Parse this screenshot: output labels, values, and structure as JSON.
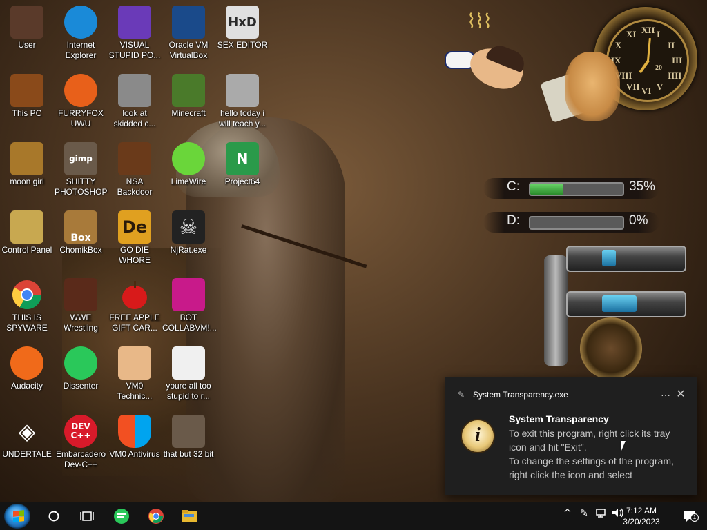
{
  "desktop": {
    "icons": [
      {
        "label": "User",
        "icon": "user-folder-icon",
        "color": "#5a3a2a"
      },
      {
        "label": "Internet Explorer",
        "icon": "edge-icon",
        "color": "#1a8ad8"
      },
      {
        "label": "VISUAL STUPID PO...",
        "icon": "visual-studio-icon",
        "color": "#6a3ab8"
      },
      {
        "label": "Oracle VM VirtualBox",
        "icon": "virtualbox-icon",
        "color": "#1a4a8a"
      },
      {
        "label": "SEX EDITOR",
        "icon": "hex-editor-icon",
        "color": "#e0e0e0"
      },
      {
        "label": "This PC",
        "icon": "this-pc-icon",
        "color": "#8a4a1a"
      },
      {
        "label": "FURRYFOX UWU",
        "icon": "firefox-icon",
        "color": "#e8601a"
      },
      {
        "label": "look at skidded c...",
        "icon": "copy-icon",
        "color": "#8a8a8a"
      },
      {
        "label": "Minecraft",
        "icon": "minecraft-icon",
        "color": "#4a7a2a"
      },
      {
        "label": "hello today i will teach y...",
        "icon": "pixel-image-icon",
        "color": "#aaaaaa"
      },
      {
        "label": "moon girl",
        "icon": "folder-icon",
        "color": "#a8782a"
      },
      {
        "label": "SHITTY PHOTOSHOP",
        "icon": "gimp-icon",
        "color": "#6a5a4a"
      },
      {
        "label": "NSA Backdoor",
        "icon": "nsa-icon",
        "color": "#6a3a1a"
      },
      {
        "label": "LimeWire",
        "icon": "limewire-icon",
        "color": "#6ad63a"
      },
      {
        "label": "Project64",
        "icon": "project64-icon",
        "color": "#2a9a4a"
      },
      {
        "label": "Control Panel",
        "icon": "control-panel-icon",
        "color": "#c8a850"
      },
      {
        "label": "ChomikBox",
        "icon": "chomikbox-icon",
        "color": "#a87a3a"
      },
      {
        "label": "GO DIE WHORE",
        "icon": "de-icon",
        "color": "#e0a020"
      },
      {
        "label": "NjRat.exe",
        "icon": "skull-icon",
        "color": "#dddddd"
      },
      {
        "label": "THIS IS SPYWARE",
        "icon": "chrome-icon",
        "color": "#db4437"
      },
      {
        "label": "WWE Wrestling",
        "icon": "wrestling-icon",
        "color": "#5a2a1a"
      },
      {
        "label": "FREE APPLE GIFT CAR...",
        "icon": "apple-icon",
        "color": "#d81a1a"
      },
      {
        "label": "BOT COLLABVM!...",
        "icon": "monitor-icon",
        "color": "#c81a8a"
      },
      {
        "label": "Audacity",
        "icon": "audacity-icon",
        "color": "#f06a1a"
      },
      {
        "label": "Dissenter",
        "icon": "dissenter-icon",
        "color": "#2ac85a"
      },
      {
        "label": "VM0 Technic...",
        "icon": "technician-icon",
        "color": "#e8b888"
      },
      {
        "label": "youre all too stupid to r...",
        "icon": "portrait-icon",
        "color": "#f0f0f0"
      },
      {
        "label": "UNDERTALE",
        "icon": "unity-icon",
        "color": "#e0e0e0"
      },
      {
        "label": "Embarcadero Dev-C++",
        "icon": "devcpp-icon",
        "color": "#d81a2a"
      },
      {
        "label": "VM0 Antivirus",
        "icon": "shield-icon",
        "color": "#1a6ad8"
      },
      {
        "label": "that but 32 bit",
        "icon": "portrait-icon",
        "color": "#6a5a4a"
      }
    ]
  },
  "icon_glyphs": {
    "hex_editor": "HxD",
    "gimp": "gimp",
    "project64": "N",
    "chomikbox": "Box",
    "de": "De",
    "devcpp_top": "DEV",
    "devcpp_bottom": "C++"
  },
  "widgets": {
    "clock": {
      "numerals": [
        "XII",
        "I",
        "II",
        "III",
        "IIII",
        "V",
        "VI",
        "VII",
        "VIII",
        "IX",
        "X",
        "XI"
      ],
      "date": "20"
    },
    "drives": [
      {
        "letter": "C:",
        "percent_text": "35%",
        "fill_fraction": 0.35
      },
      {
        "letter": "D:",
        "percent_text": "0%",
        "fill_fraction": 0.0
      }
    ]
  },
  "toast": {
    "app_name": "System Transparency.exe",
    "more_label": "···",
    "close_label": "✕",
    "title": "System Transparency",
    "body": "To exit this program, right click its tray icon and hit \"Exit\".\nTo change the settings of the program, right click the icon and select",
    "icon": "info-icon",
    "icon_glyph": "i"
  },
  "taskbar": {
    "pinned": [
      {
        "name": "cortana-icon"
      },
      {
        "name": "task-view-icon"
      },
      {
        "name": "dissenter-icon"
      },
      {
        "name": "chrome-icon"
      },
      {
        "name": "file-explorer-icon"
      }
    ],
    "tray": {
      "chevron": "^",
      "time": "7:12 AM",
      "date": "3/20/2023",
      "notification_count": "1"
    }
  },
  "colors": {
    "taskbar_bg": "#141414",
    "toast_bg": "#1f1f1f",
    "meter_fill": "#3aa83a"
  }
}
